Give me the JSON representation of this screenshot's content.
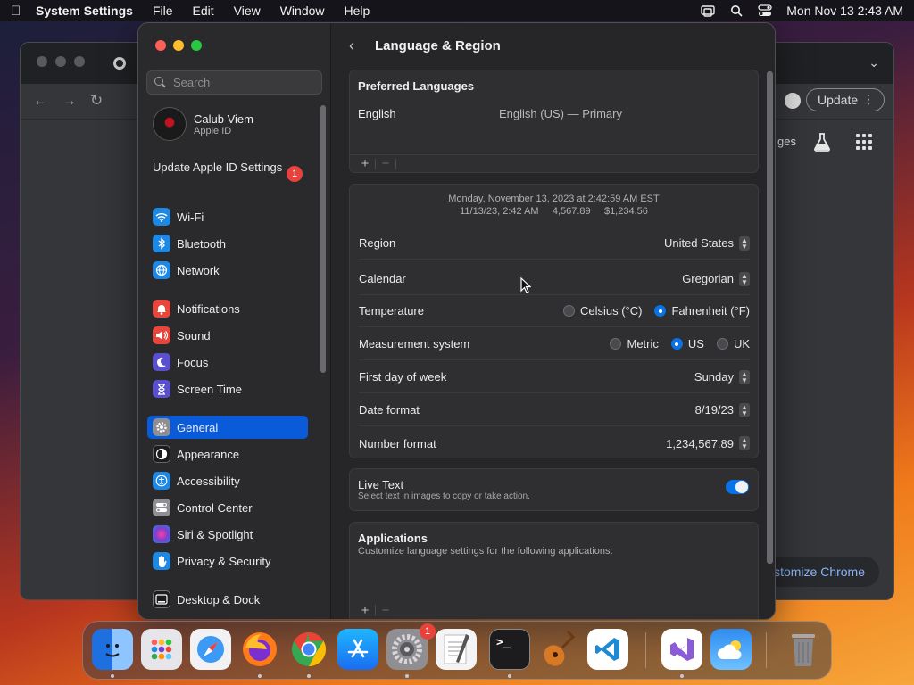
{
  "menubar": {
    "app_name": "System Settings",
    "menus": [
      "File",
      "Edit",
      "View",
      "Window",
      "Help"
    ],
    "datetime": "Mon Nov 13  2:43 AM"
  },
  "chrome": {
    "update_label": "Update",
    "partial_text": "ges",
    "customize_label": "ustomize Chrome"
  },
  "sidebar": {
    "search_placeholder": "Search",
    "user_name": "Calub Viem",
    "user_sub": "Apple ID",
    "update_apple_id": "Update Apple ID Settings",
    "update_badge": "1",
    "items": [
      {
        "label": "Wi-Fi",
        "icon": "wifi-icon",
        "color": "#1e88e5"
      },
      {
        "label": "Bluetooth",
        "icon": "bluetooth-icon",
        "color": "#1e88e5"
      },
      {
        "label": "Network",
        "icon": "globe-icon",
        "color": "#1e88e5"
      },
      {
        "label": "Notifications",
        "icon": "bell-icon",
        "color": "#e8453c"
      },
      {
        "label": "Sound",
        "icon": "speaker-icon",
        "color": "#e8453c"
      },
      {
        "label": "Focus",
        "icon": "moon-icon",
        "color": "#5a4fcf"
      },
      {
        "label": "Screen Time",
        "icon": "hourglass-icon",
        "color": "#5a4fcf"
      },
      {
        "label": "General",
        "icon": "gear-icon",
        "color": "#8e8e93"
      },
      {
        "label": "Appearance",
        "icon": "appearance-icon",
        "color": "#1c1c1e"
      },
      {
        "label": "Accessibility",
        "icon": "accessibility-icon",
        "color": "#1e88e5"
      },
      {
        "label": "Control Center",
        "icon": "toggles-icon",
        "color": "#8e8e93"
      },
      {
        "label": "Siri & Spotlight",
        "icon": "siri-icon",
        "color": "#7a3fd0"
      },
      {
        "label": "Privacy & Security",
        "icon": "hand-icon",
        "color": "#1e88e5"
      },
      {
        "label": "Desktop & Dock",
        "icon": "dock-icon",
        "color": "#1c1c1e"
      }
    ]
  },
  "content": {
    "title": "Language & Region",
    "preferred_languages": {
      "heading": "Preferred Languages",
      "language": "English",
      "language_detail": "English (US) — Primary",
      "add": "+",
      "remove": "−"
    },
    "preview": {
      "line1": "Monday, November 13, 2023 at 2:42:59 AM EST",
      "line2": "11/13/23, 2:42 AM     4,567.89     $1,234.56"
    },
    "settings": {
      "region_label": "Region",
      "region_value": "United States",
      "calendar_label": "Calendar",
      "calendar_value": "Gregorian",
      "temperature_label": "Temperature",
      "temp_celsius": "Celsius (°C)",
      "temp_fahrenheit": "Fahrenheit (°F)",
      "temperature_selected": "Fahrenheit (°F)",
      "measurement_label": "Measurement system",
      "measure_metric": "Metric",
      "measure_us": "US",
      "measure_uk": "UK",
      "measurement_selected": "US",
      "first_day_label": "First day of week",
      "first_day_value": "Sunday",
      "date_format_label": "Date format",
      "date_format_value": "8/19/23",
      "number_format_label": "Number format",
      "number_format_value": "1,234,567.89"
    },
    "live_text": {
      "label": "Live Text",
      "sub": "Select text in images to copy or take action.",
      "enabled": true
    },
    "applications": {
      "heading": "Applications",
      "sub": "Customize language settings for the following applications:",
      "add": "+",
      "remove": "−"
    }
  },
  "dock": {
    "apps": [
      {
        "name": "Finder",
        "icon": "finder-icon",
        "color": "#2f8cf0"
      },
      {
        "name": "Launchpad",
        "icon": "launchpad-icon",
        "color": "#d8d8dc"
      },
      {
        "name": "Safari",
        "icon": "safari-icon",
        "color": "#3a9af5"
      },
      {
        "name": "Firefox",
        "icon": "firefox-icon",
        "color": "#ff7a18"
      },
      {
        "name": "Chrome",
        "icon": "chrome-icon",
        "color": "#34a853"
      },
      {
        "name": "App Store",
        "icon": "appstore-icon",
        "color": "#1a8cf5"
      },
      {
        "name": "System Settings",
        "icon": "settings-icon",
        "color": "#8e8e93"
      },
      {
        "name": "TextEdit",
        "icon": "textedit-icon",
        "color": "#f0f0f0"
      },
      {
        "name": "Terminal",
        "icon": "terminal-icon",
        "color": "#1c1c1e"
      },
      {
        "name": "GarageBand",
        "icon": "guitar-icon",
        "color": "#d87a25"
      },
      {
        "name": "VS Code",
        "icon": "vscode-icon",
        "color": "#ffffff"
      },
      {
        "name": "Visual Studio",
        "icon": "visualstudio-icon",
        "color": "#ffffff"
      },
      {
        "name": "Weather",
        "icon": "weather-icon",
        "color": "#2f8cf0"
      },
      {
        "name": "Trash",
        "icon": "trash-icon",
        "color": "#9a9a9e"
      }
    ],
    "settings_badge": "1",
    "terminal_glyph": ">_"
  }
}
